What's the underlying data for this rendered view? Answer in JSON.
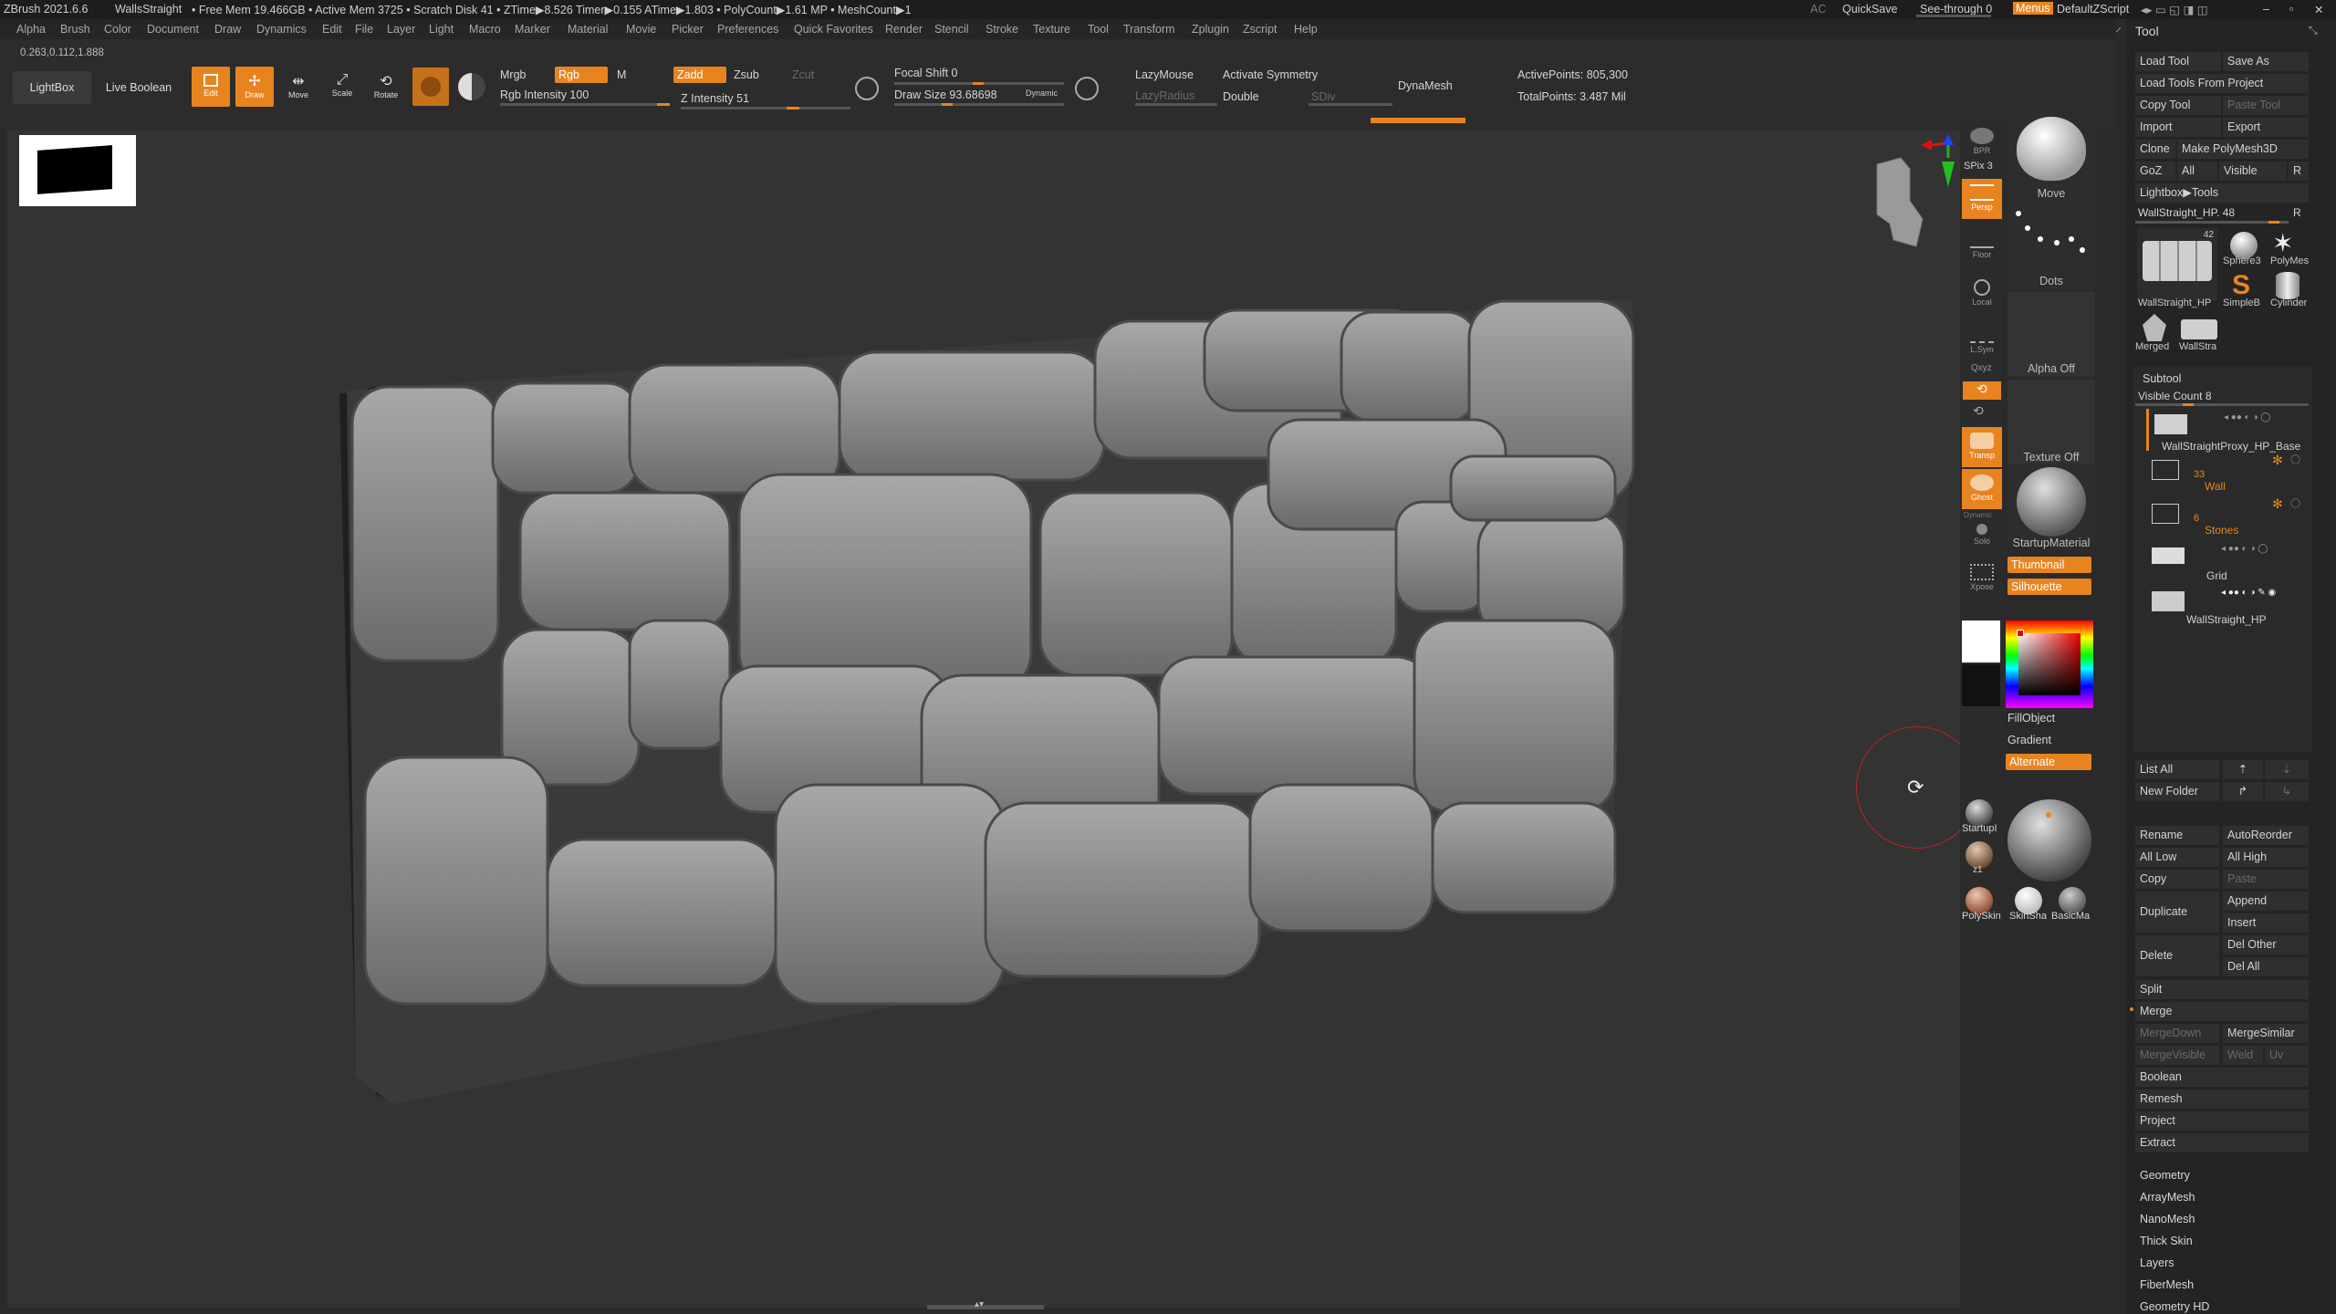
{
  "titlebar": {
    "app": "ZBrush 2021.6.6",
    "doc": "WallsStraight",
    "stats": "• Free Mem 19.466GB • Active Mem 3725 • Scratch Disk 41 •  ZTime▶8.526 Timer▶0.155 ATime▶1.803 • PolyCount▶1.61 MP  • MeshCount▶1",
    "ac": "AC",
    "quicksave": "QuickSave",
    "see_through": "See-through  0",
    "menus": "Menus",
    "default_script": "DefaultZScript"
  },
  "menubar": [
    "Alpha",
    "Brush",
    "Color",
    "Document",
    "Draw",
    "Dynamics",
    "Edit",
    "File",
    "Layer",
    "Light",
    "Macro",
    "Marker",
    "Material",
    "Movie",
    "Picker",
    "Preferences",
    "Quick Favorites",
    "Render",
    "Stencil",
    "Stroke",
    "Texture",
    "Tool",
    "Transform",
    "Zplugin",
    "Zscript",
    "Help"
  ],
  "coords": "0.263,0.112,1.888",
  "toolbar": {
    "lightbox": "LightBox",
    "live_boolean": "Live Boolean",
    "edit": "Edit",
    "draw": "Draw",
    "move": "Move",
    "scale": "Scale",
    "rotate": "Rotate",
    "mrgb": "Mrgb",
    "rgb": "Rgb",
    "m": "M",
    "rgb_intensity": "Rgb Intensity 100",
    "zadd": "Zadd",
    "zsub": "Zsub",
    "zcut": "Zcut",
    "z_intensity": "Z Intensity 51",
    "focal_shift": "Focal Shift 0",
    "draw_size": "Draw Size 93.68698",
    "dynamic": "Dynamic",
    "lazymouse": "LazyMouse",
    "lazyradius": "LazyRadius",
    "activate_symmetry": "Activate Symmetry",
    "double": "Double",
    "sdiv": "SDiv",
    "dynamesh": "DynaMesh",
    "active_points": "ActivePoints: 805,300",
    "total_points": "TotalPoints: 3.487 Mil"
  },
  "shelf": {
    "bpr": "BPR",
    "spix": "SPix 3",
    "persp": "Persp",
    "floor": "Floor",
    "local": "Local",
    "lsym": "L.Sym",
    "xyz": "Qxyz",
    "transp": "Transp",
    "ghost": "Ghost",
    "dynamic": "Dynamic",
    "solo": "Solo",
    "xpose": "Xpose"
  },
  "palette": {
    "brush": "Move",
    "stroke": "Dots",
    "alpha": "Alpha Off",
    "texture": "Texture Off",
    "material": "StartupMaterial",
    "thumbnail": "Thumbnail",
    "silhouette": "Silhouette",
    "fillobject": "FillObject",
    "gradient": "Gradient",
    "alternate": "Alternate",
    "mat_startup": "StartupI",
    "mat_z1": "z1",
    "mat_polyskin": "PolySkin",
    "mat_skinsha": "SkinSha",
    "mat_basicma": "BasicMa"
  },
  "tool_panel": {
    "title": "Tool",
    "load_tool": "Load Tool",
    "save_as": "Save As",
    "load_tools_from_project": "Load Tools From Project",
    "copy_tool": "Copy Tool",
    "paste_tool": "Paste Tool",
    "import": "Import",
    "export": "Export",
    "clone": "Clone",
    "make_polymesh": "Make PolyMesh3D",
    "goz": "GoZ",
    "all": "All",
    "visible": "Visible",
    "r": "R",
    "lightbox_tools": "Lightbox▶Tools",
    "current_tool": "WallStraight_HP. 48",
    "thumbs": [
      {
        "label": "WallStraight_HP",
        "badge": "42"
      },
      {
        "label": "Sphere3"
      },
      {
        "label": "PolyMes"
      },
      {
        "label": "SimpleB"
      },
      {
        "label": "Cylinder"
      },
      {
        "label": "Merged"
      },
      {
        "label": "WallStra"
      }
    ],
    "subtool_title": "Subtool",
    "visible_count": "Visible Count 8",
    "subtools": [
      {
        "name": "WallStraightProxy_HP_Base",
        "count": ""
      },
      {
        "name": "Wall",
        "count": "33"
      },
      {
        "name": "Stones",
        "count": "6"
      },
      {
        "name": "Grid",
        "count": ""
      },
      {
        "name": "WallStraight_HP",
        "count": ""
      }
    ],
    "list_all": "List All",
    "new_folder": "New Folder",
    "rename": "Rename",
    "autoreorder": "AutoReorder",
    "all_low": "All Low",
    "all_high": "All High",
    "copy": "Copy",
    "paste": "Paste",
    "duplicate": "Duplicate",
    "append": "Append",
    "insert": "Insert",
    "delete": "Delete",
    "del_other": "Del Other",
    "del_all": "Del All",
    "split": "Split",
    "merge": "Merge",
    "mergedown": "MergeDown",
    "mergesimilar": "MergeSimilar",
    "mergevisible": "MergeVisible",
    "weld": "Weld",
    "uv": "Uv",
    "boolean": "Boolean",
    "remesh": "Remesh",
    "project": "Project",
    "extract": "Extract",
    "sections": [
      "Geometry",
      "ArrayMesh",
      "NanoMesh",
      "Thick Skin",
      "Layers",
      "FiberMesh",
      "Geometry HD"
    ]
  },
  "colors": {
    "accent": "#e8841f",
    "background": "#2a2a2a",
    "viewport": "#333333"
  }
}
